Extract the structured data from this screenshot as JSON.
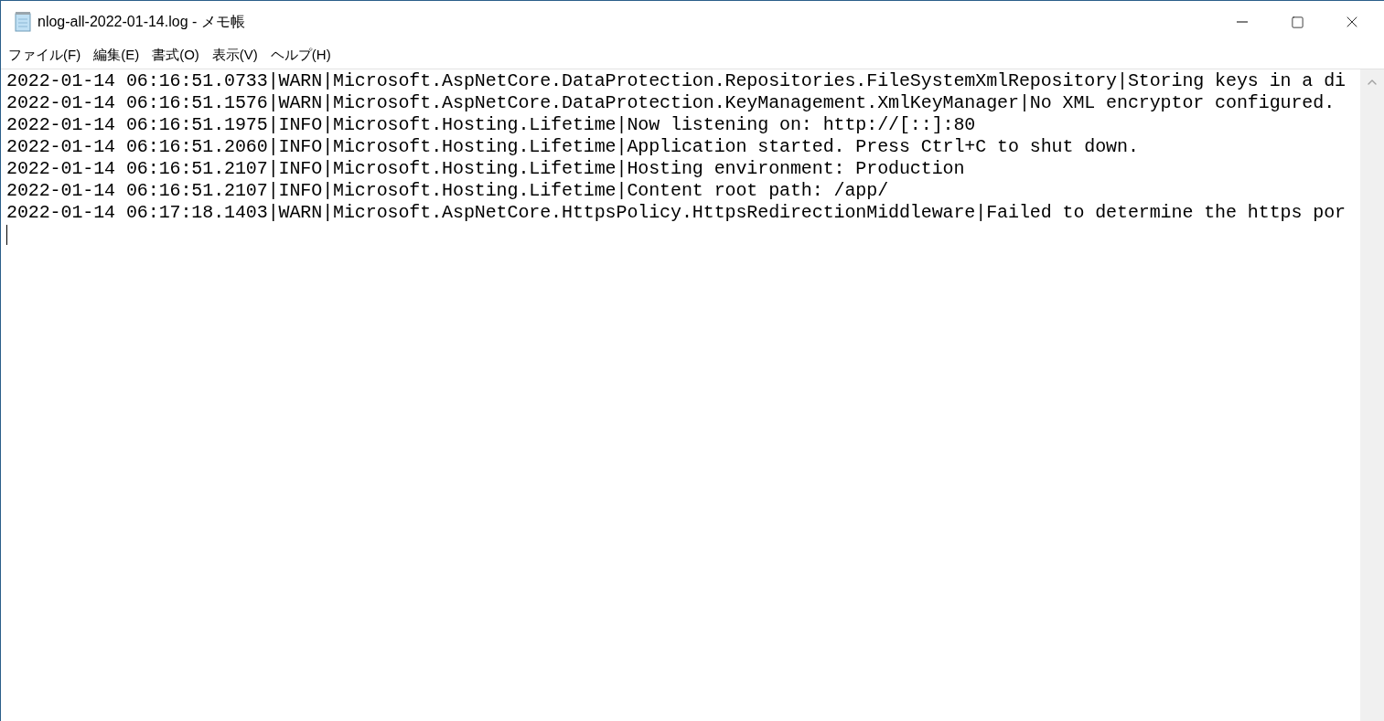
{
  "window": {
    "title": "nlog-all-2022-01-14.log - メモ帳"
  },
  "menu": [
    "ファイル(F)",
    "編集(E)",
    "書式(O)",
    "表示(V)",
    "ヘルプ(H)"
  ],
  "editor": {
    "lines": [
      "2022-01-14 06:16:51.0733|WARN|Microsoft.AspNetCore.DataProtection.Repositories.FileSystemXmlRepository|Storing keys in a di",
      "2022-01-14 06:16:51.1576|WARN|Microsoft.AspNetCore.DataProtection.KeyManagement.XmlKeyManager|No XML encryptor configured.",
      "2022-01-14 06:16:51.1975|INFO|Microsoft.Hosting.Lifetime|Now listening on: http://[::]:80",
      "2022-01-14 06:16:51.2060|INFO|Microsoft.Hosting.Lifetime|Application started. Press Ctrl+C to shut down.",
      "2022-01-14 06:16:51.2107|INFO|Microsoft.Hosting.Lifetime|Hosting environment: Production",
      "2022-01-14 06:16:51.2107|INFO|Microsoft.Hosting.Lifetime|Content root path: /app/",
      "2022-01-14 06:17:18.1403|WARN|Microsoft.AspNetCore.HttpsPolicy.HttpsRedirectionMiddleware|Failed to determine the https por"
    ]
  }
}
